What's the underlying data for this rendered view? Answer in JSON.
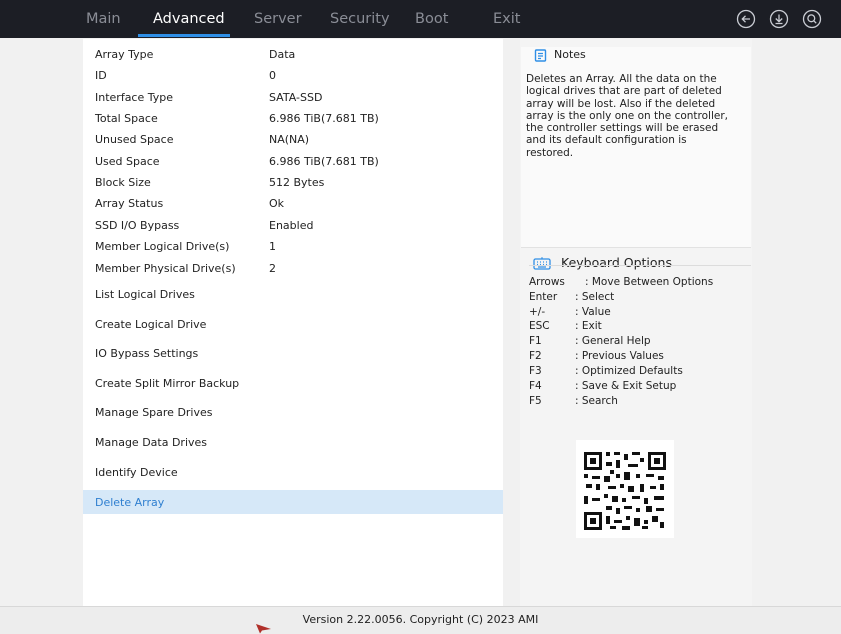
{
  "tabs": [
    {
      "label": "Main"
    },
    {
      "label": "Advanced"
    },
    {
      "label": "Server"
    },
    {
      "label": "Security"
    },
    {
      "label": "Boot"
    },
    {
      "label": "Exit"
    }
  ],
  "active_tab": "Advanced",
  "top_icons": [
    "back-icon",
    "download-icon",
    "search-icon"
  ],
  "info_rows": [
    {
      "label": "Array Type",
      "value": "Data"
    },
    {
      "label": "ID",
      "value": "0"
    },
    {
      "label": "Interface Type",
      "value": "SATA-SSD"
    },
    {
      "label": "Total Space",
      "value": "6.986 TiB(7.681 TB)"
    },
    {
      "label": "Unused Space",
      "value": "NA(NA)"
    },
    {
      "label": "Used Space",
      "value": "6.986 TiB(7.681 TB)"
    },
    {
      "label": "Block Size",
      "value": "512 Bytes"
    },
    {
      "label": "Array Status",
      "value": "Ok"
    },
    {
      "label": "SSD I/O Bypass",
      "value": "Enabled"
    },
    {
      "label": "Member Logical Drive(s)",
      "value": "1"
    },
    {
      "label": "Member Physical Drive(s)",
      "value": "2"
    }
  ],
  "actions": [
    {
      "label": "List Logical Drives"
    },
    {
      "label": "Create Logical Drive"
    },
    {
      "label": "IO Bypass Settings"
    },
    {
      "label": "Create Split Mirror Backup"
    },
    {
      "label": "Manage Spare Drives"
    },
    {
      "label": "Manage Data Drives"
    },
    {
      "label": "Identify Device"
    },
    {
      "label": "Delete Array"
    }
  ],
  "selected_action": "Delete Array",
  "notes": {
    "title": "Notes",
    "lines": [
      "Deletes an Array. All the data on the",
      "logical drives that are part of deleted",
      "array will be lost. Also if the deleted",
      "array is the only one on the controller,",
      "the controller settings will be erased",
      "and its default configuration is",
      "restored."
    ]
  },
  "keyboard": {
    "title": "Keyboard Options",
    "rows": [
      {
        "key": "Arrows",
        "desc": ": Move Between Options"
      },
      {
        "key": "Enter",
        "desc": ": Select"
      },
      {
        "key": "+/-",
        "desc": ": Value"
      },
      {
        "key": "ESC",
        "desc": ": Exit"
      },
      {
        "key": "F1",
        "desc": ": General Help"
      },
      {
        "key": "F2",
        "desc": ": Previous Values"
      },
      {
        "key": "F3",
        "desc": ": Optimized Defaults"
      },
      {
        "key": "F4",
        "desc": ": Save & Exit Setup"
      },
      {
        "key": "F5",
        "desc": ": Search"
      }
    ]
  },
  "footer": {
    "text": "Version 2.22.0056. Copyright (C) 2023 AMI"
  },
  "colors": {
    "topbar": "#1c1e25",
    "accent": "#2f8fe6",
    "selected_bg": "#d6e8f8",
    "selected_text": "#2f7fd0"
  }
}
